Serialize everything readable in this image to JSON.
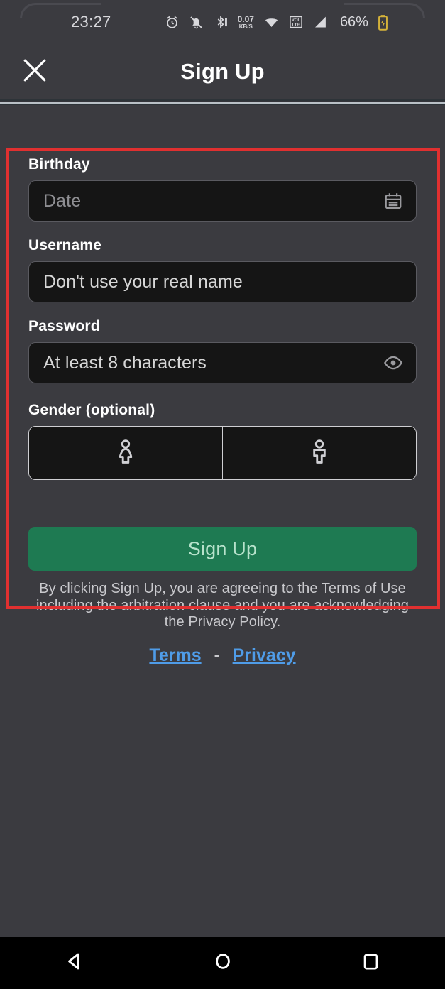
{
  "statusbar": {
    "clock": "23:27",
    "icons": [
      {
        "name": "alarm-icon"
      },
      {
        "name": "notifications-muted-icon"
      },
      {
        "name": "bluetooth-icon"
      },
      {
        "name": "network-speed-icon"
      },
      {
        "name": "wifi-icon"
      },
      {
        "name": "volte-icon"
      },
      {
        "name": "cellular-signal-icon"
      }
    ],
    "network_rate_value": "0.07",
    "network_rate_unit": "KB/S",
    "volte_label_top": "VOL",
    "volte_label_bottom": "LTE",
    "battery_percent": "66%",
    "battery_icon_name": "battery-charging-icon"
  },
  "appbar": {
    "close_icon_name": "close-icon",
    "title": "Sign Up"
  },
  "form": {
    "birthday": {
      "label": "Birthday",
      "placeholder": "Date",
      "value": "",
      "trailing_icon_name": "calendar-icon"
    },
    "username": {
      "label": "Username",
      "placeholder": "Don't use your real name",
      "value": ""
    },
    "password": {
      "label": "Password",
      "placeholder": "At least 8 characters",
      "value": "",
      "trailing_icon_name": "eye-icon"
    },
    "gender": {
      "label": "Gender (optional)",
      "options": [
        {
          "icon_name": "female-person-icon",
          "selected": false
        },
        {
          "icon_name": "male-person-icon",
          "selected": false
        }
      ]
    }
  },
  "signup": {
    "button_label": "Sign Up"
  },
  "legal": {
    "disclaimer": "By clicking Sign Up, you are agreeing to the Terms of Use including the arbitration clause and you are acknowledging the Privacy Policy.",
    "terms_link": "Terms",
    "separator": "-",
    "privacy_link": "Privacy"
  },
  "navbar": {
    "back_icon_name": "back-triangle-icon",
    "home_icon_name": "home-circle-icon",
    "recents_icon_name": "recents-square-icon"
  },
  "colors": {
    "background": "#3b3b40",
    "field_background": "#151515",
    "accent_green": "#1e7a52",
    "link_blue": "#4f9ce8",
    "annotation_red": "#e03030"
  }
}
